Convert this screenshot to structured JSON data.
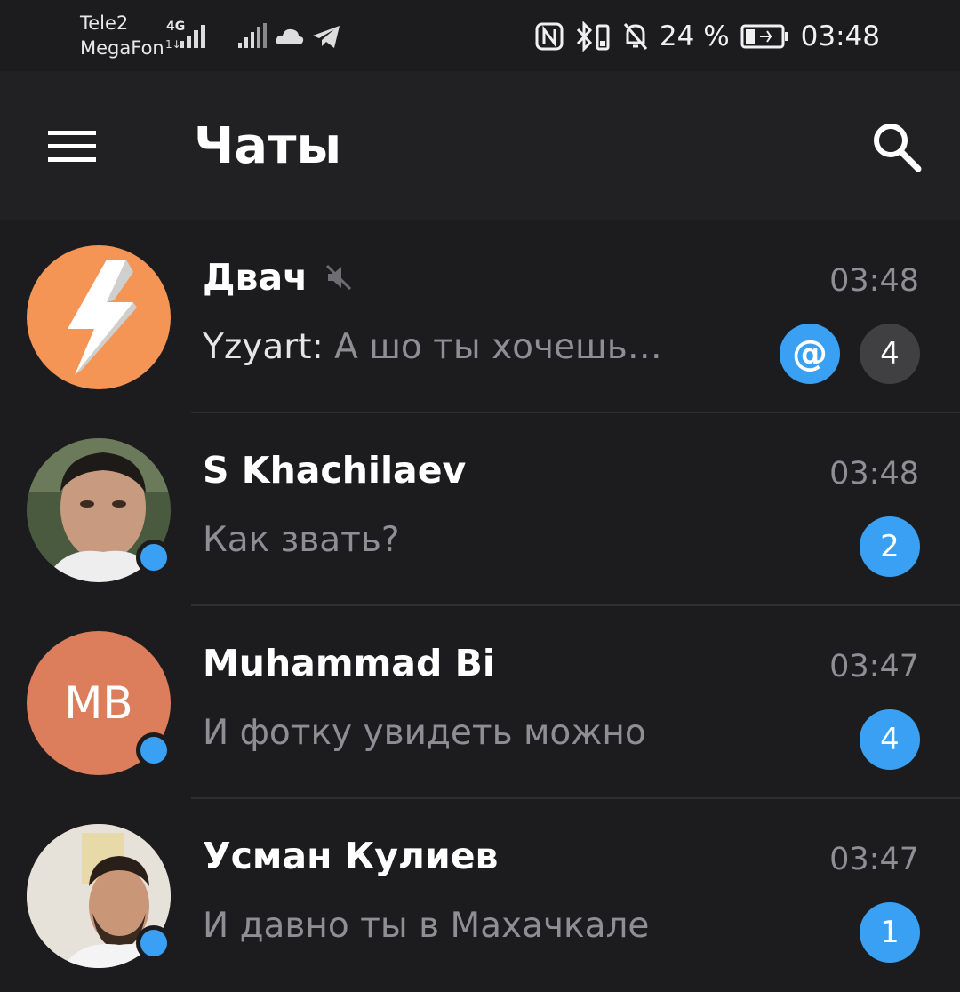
{
  "status_bar": {
    "carrier_1": "Tele2",
    "carrier_2": "MegaFon",
    "network_type": "4G",
    "battery_percent": "24 %",
    "time": "03:48",
    "icons": [
      "signal-icon",
      "cloud-icon",
      "telegram-icon",
      "nfc-icon",
      "bluetooth-icon",
      "vibrate-icon",
      "mute-icon",
      "battery-icon"
    ]
  },
  "header": {
    "title": "Чаты"
  },
  "chats": [
    {
      "name": "Двач",
      "muted": true,
      "time": "03:48",
      "sender": "Yzyart: ",
      "message": "А шо ты хочешь…",
      "mention": "@",
      "unread": "4",
      "badge_color": "#404043",
      "avatar_color": "#f59555"
    },
    {
      "name": "S Khachilaev",
      "time": "03:48",
      "message": "Как звать?",
      "unread": "2",
      "badge_color": "#3aa0f4",
      "online": true
    },
    {
      "name": "Muhammad Bi",
      "time": "03:47",
      "message": "И фотку увидеть можно",
      "unread": "4",
      "badge_color": "#3aa0f4",
      "avatar_initials": "MB",
      "avatar_color": "#dc7e5c",
      "online": true
    },
    {
      "name": "Усман Кулиев",
      "time": "03:47",
      "message": "И давно ты в Махачкале",
      "unread": "1",
      "badge_color": "#3aa0f4",
      "online": true
    }
  ],
  "colors": {
    "accent": "#3aa0f4",
    "background": "#1c1c1e",
    "header": "#212124",
    "secondary_text": "#8e8e93"
  }
}
